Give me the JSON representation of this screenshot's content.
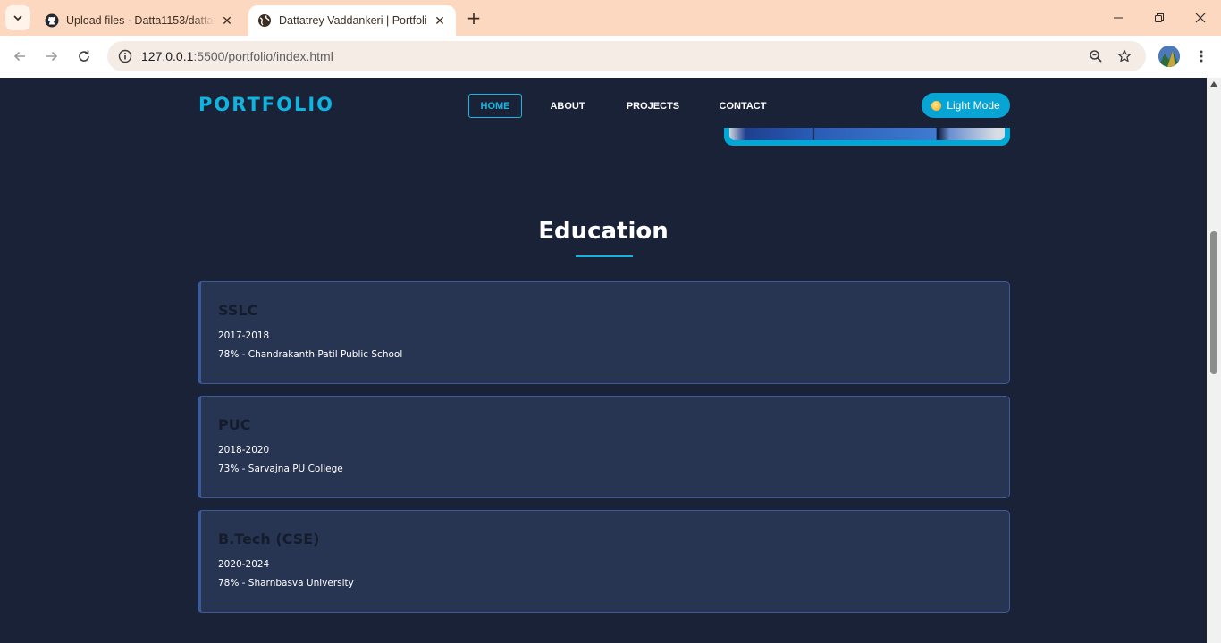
{
  "browser": {
    "tabs": [
      {
        "title": "Upload files · Datta1153/dattatrey",
        "active": false,
        "icon": "github-icon"
      },
      {
        "title": "Dattatrey Vaddankeri | Portfolio",
        "active": true,
        "icon": "globe-icon"
      }
    ],
    "url_host": "127.0.0.1",
    "url_path": ":5500/portfolio/index.html"
  },
  "site": {
    "logo": "PORTFOLIO",
    "nav": [
      {
        "label": "HOME",
        "active": true
      },
      {
        "label": "ABOUT",
        "active": false
      },
      {
        "label": "PROJECTS",
        "active": false
      },
      {
        "label": "CONTACT",
        "active": false
      }
    ],
    "theme_button": "Light Mode",
    "colors": {
      "accent": "#10b4e0",
      "background": "#1a2238",
      "card": "#283552",
      "card_border": "#3c5a9a"
    }
  },
  "education": {
    "title": "Education",
    "items": [
      {
        "degree": "SSLC",
        "years": "2017-2018",
        "detail": "78% - Chandrakanth Patil Public School"
      },
      {
        "degree": "PUC",
        "years": "2018-2020",
        "detail": "73% - Sarvajna PU College"
      },
      {
        "degree": "B.Tech (CSE)",
        "years": "2020-2024",
        "detail": "78% - Sharnbasva University"
      }
    ]
  }
}
